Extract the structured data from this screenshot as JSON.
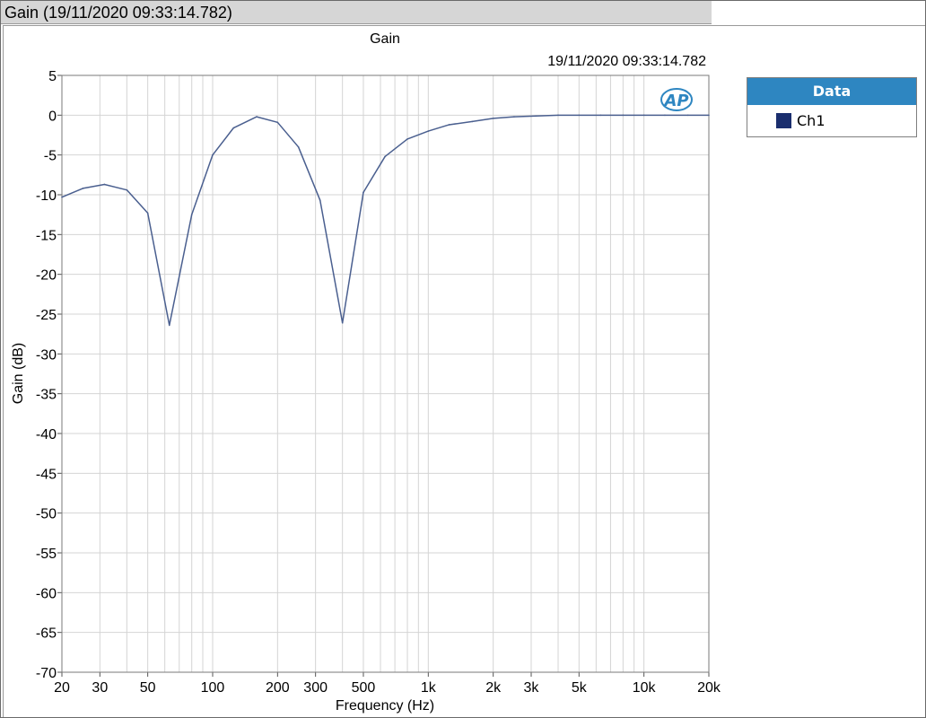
{
  "window": {
    "tab_title": "Gain (19/11/2020 09:33:14.782)"
  },
  "legend": {
    "header": "Data",
    "items": [
      {
        "label": "Ch1",
        "color": "#1a2e6e"
      }
    ]
  },
  "logo": {
    "text": "AP"
  },
  "chart_data": {
    "type": "line",
    "title": "Gain",
    "subtitle": "19/11/2020 09:33:14.782",
    "xlabel": "Frequency (Hz)",
    "ylabel": "Gain (dB)",
    "xscale": "log",
    "xlim": [
      20,
      20000
    ],
    "ylim": [
      -70,
      5
    ],
    "grid": true,
    "legend_position": "right",
    "xticks": [
      {
        "value": 20,
        "label": "20"
      },
      {
        "value": 30,
        "label": "30"
      },
      {
        "value": 50,
        "label": "50"
      },
      {
        "value": 100,
        "label": "100"
      },
      {
        "value": 200,
        "label": "200"
      },
      {
        "value": 300,
        "label": "300"
      },
      {
        "value": 500,
        "label": "500"
      },
      {
        "value": 1000,
        "label": "1k"
      },
      {
        "value": 2000,
        "label": "2k"
      },
      {
        "value": 3000,
        "label": "3k"
      },
      {
        "value": 5000,
        "label": "5k"
      },
      {
        "value": 10000,
        "label": "10k"
      },
      {
        "value": 20000,
        "label": "20k"
      }
    ],
    "yticks": [
      {
        "value": 5,
        "label": "5"
      },
      {
        "value": 0,
        "label": "0"
      },
      {
        "value": -5,
        "label": "-5"
      },
      {
        "value": -10,
        "label": "-10"
      },
      {
        "value": -15,
        "label": "-15"
      },
      {
        "value": -20,
        "label": "-20"
      },
      {
        "value": -25,
        "label": "-25"
      },
      {
        "value": -30,
        "label": "-30"
      },
      {
        "value": -35,
        "label": "-35"
      },
      {
        "value": -40,
        "label": "-40"
      },
      {
        "value": -45,
        "label": "-45"
      },
      {
        "value": -50,
        "label": "-50"
      },
      {
        "value": -55,
        "label": "-55"
      },
      {
        "value": -60,
        "label": "-60"
      },
      {
        "value": -65,
        "label": "-65"
      },
      {
        "value": -70,
        "label": "-70"
      }
    ],
    "series": [
      {
        "name": "Ch1",
        "color": "#4a5f8f",
        "points": [
          [
            20,
            -10.3
          ],
          [
            25,
            -9.2
          ],
          [
            31.5,
            -8.7
          ],
          [
            40,
            -9.4
          ],
          [
            50,
            -12.3
          ],
          [
            63,
            -26.4
          ],
          [
            80,
            -12.5
          ],
          [
            100,
            -5.0
          ],
          [
            125,
            -1.6
          ],
          [
            160,
            -0.2
          ],
          [
            200,
            -0.9
          ],
          [
            250,
            -4.0
          ],
          [
            315,
            -10.7
          ],
          [
            400,
            -26.1
          ],
          [
            500,
            -9.7
          ],
          [
            630,
            -5.2
          ],
          [
            800,
            -3.0
          ],
          [
            1000,
            -2.0
          ],
          [
            1250,
            -1.2
          ],
          [
            1600,
            -0.8
          ],
          [
            2000,
            -0.4
          ],
          [
            2500,
            -0.2
          ],
          [
            3150,
            -0.1
          ],
          [
            4000,
            0.0
          ],
          [
            5000,
            0.0
          ],
          [
            6300,
            0.0
          ],
          [
            8000,
            0.0
          ],
          [
            10000,
            0.0
          ],
          [
            12500,
            0.0
          ],
          [
            16000,
            0.0
          ],
          [
            20000,
            0.0
          ]
        ]
      }
    ]
  }
}
